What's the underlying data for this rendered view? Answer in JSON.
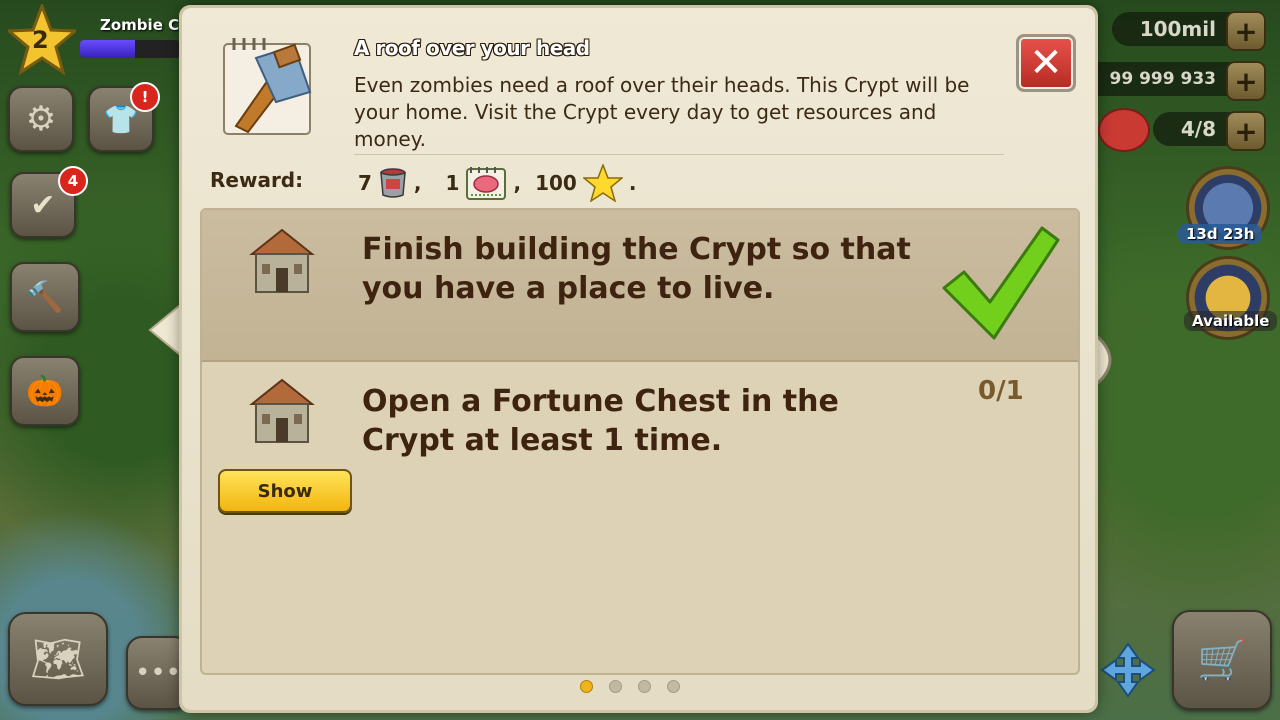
{
  "hud": {
    "level": "2",
    "player_name": "Zombie Ca",
    "xp_progress": 0.55,
    "quests_badge": "4",
    "wardrobe_badge": "!",
    "money": "100mil",
    "coins": "99 999 933",
    "brains": "4/8",
    "event_timer": "13d 23h",
    "bonus_status": "Available"
  },
  "dialog": {
    "title": "A roof over your head",
    "description": "Even zombies need a roof over their heads. This Crypt will be your home. Visit the Crypt every day to get resources and money.",
    "reward_label": "Reward:",
    "rewards": [
      {
        "amount": "7",
        "icon": "paint-bucket-icon",
        "sep": ","
      },
      {
        "amount": "1",
        "icon": "brain-calendar-icon",
        "sep": ","
      },
      {
        "amount": "100",
        "icon": "star-icon",
        "sep": "."
      }
    ],
    "tasks": [
      {
        "text": "Finish building the Crypt so that you have a place to live.",
        "completed": true
      },
      {
        "text": "Open a Fortune Chest in the Crypt at least 1 time.",
        "progress": "0/1",
        "button_label": "Show"
      }
    ],
    "page_count": 4,
    "current_page": 1
  },
  "colors": {
    "parchment": "#e8e0ca",
    "text_brown": "#3e2410",
    "check_green": "#6fce1b",
    "close_red": "#d8423a",
    "show_yellow": "#f6c21a"
  }
}
